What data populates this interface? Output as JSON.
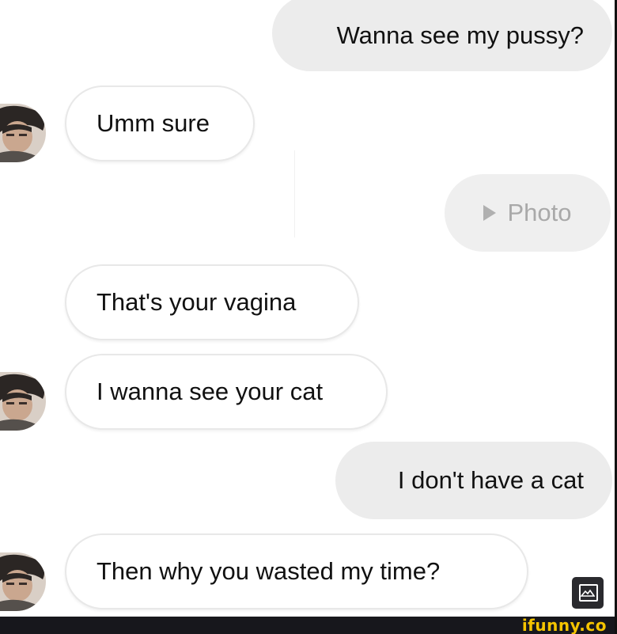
{
  "messages": [
    {
      "side": "outgoing",
      "text": "Wanna see my pussy?"
    },
    {
      "side": "incoming",
      "text": "Umm sure"
    },
    {
      "side": "outgoing",
      "type": "photo",
      "text": "Photo",
      "icon": "play-icon"
    },
    {
      "side": "incoming",
      "text": "That's your vagina"
    },
    {
      "side": "incoming",
      "text": "I wanna see your cat"
    },
    {
      "side": "outgoing",
      "text": "I don't have a cat"
    },
    {
      "side": "incoming",
      "text": "Then why you wasted my time?"
    }
  ],
  "watermark": {
    "text": "ifunny.co"
  },
  "colors": {
    "incoming_bubble": "#ffffff",
    "outgoing_bubble": "#ececec",
    "watermark": "#f5c400",
    "footer_bar": "#17171c"
  }
}
